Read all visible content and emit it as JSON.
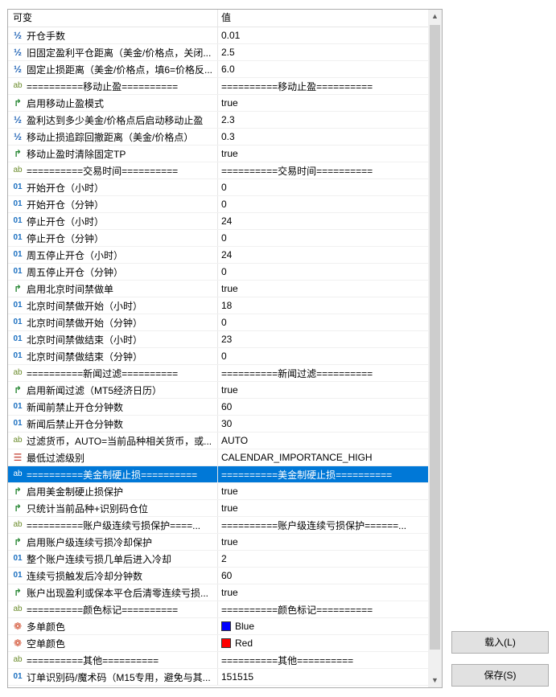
{
  "header": {
    "col1": "可变",
    "col2": "值"
  },
  "rows": [
    {
      "type": "double",
      "name": "开仓手数",
      "value": "0.01"
    },
    {
      "type": "double",
      "name": "旧固定盈利平仓距离（美金/价格点，关闭...",
      "value": "2.5"
    },
    {
      "type": "double",
      "name": "固定止损距离（美金/价格点，填6=价格反...",
      "value": "6.0"
    },
    {
      "type": "string",
      "name": "==========移动止盈==========",
      "value": "==========移动止盈=========="
    },
    {
      "type": "bool",
      "name": "启用移动止盈模式",
      "value": "true"
    },
    {
      "type": "double",
      "name": "盈利达到多少美金/价格点后启动移动止盈",
      "value": "2.3"
    },
    {
      "type": "double",
      "name": "移动止损追踪回撤距离（美金/价格点）",
      "value": "0.3"
    },
    {
      "type": "bool",
      "name": "移动止盈时清除固定TP",
      "value": "true"
    },
    {
      "type": "string",
      "name": "==========交易时间==========",
      "value": "==========交易时间=========="
    },
    {
      "type": "int",
      "name": "开始开仓（小时）",
      "value": "0"
    },
    {
      "type": "int",
      "name": "开始开仓（分钟）",
      "value": "0"
    },
    {
      "type": "int",
      "name": "停止开仓（小时）",
      "value": "24"
    },
    {
      "type": "int",
      "name": "停止开仓（分钟）",
      "value": "0"
    },
    {
      "type": "int",
      "name": "周五停止开仓（小时）",
      "value": "24"
    },
    {
      "type": "int",
      "name": "周五停止开仓（分钟）",
      "value": "0"
    },
    {
      "type": "bool",
      "name": "启用北京时间禁做单",
      "value": "true"
    },
    {
      "type": "int",
      "name": "北京时间禁做开始（小时）",
      "value": "18"
    },
    {
      "type": "int",
      "name": "北京时间禁做开始（分钟）",
      "value": "0"
    },
    {
      "type": "int",
      "name": "北京时间禁做结束（小时）",
      "value": "23"
    },
    {
      "type": "int",
      "name": "北京时间禁做结束（分钟）",
      "value": "0"
    },
    {
      "type": "string",
      "name": "==========新闻过滤==========",
      "value": "==========新闻过滤=========="
    },
    {
      "type": "bool",
      "name": "启用新闻过滤（MT5经济日历）",
      "value": "true"
    },
    {
      "type": "int",
      "name": "新闻前禁止开仓分钟数",
      "value": "60"
    },
    {
      "type": "int",
      "name": "新闻后禁止开仓分钟数",
      "value": "30"
    },
    {
      "type": "string",
      "name": "过滤货币，AUTO=当前品种相关货币，或...",
      "value": "AUTO"
    },
    {
      "type": "enum",
      "name": "最低过滤级别",
      "value": "CALENDAR_IMPORTANCE_HIGH"
    },
    {
      "type": "string",
      "name": "==========美金制硬止损==========",
      "value": "==========美金制硬止损==========",
      "selected": true
    },
    {
      "type": "bool",
      "name": "启用美金制硬止损保护",
      "value": "true"
    },
    {
      "type": "bool",
      "name": "只统计当前品种+识别码仓位",
      "value": "true"
    },
    {
      "type": "string",
      "name": "==========账户级连续亏损保护====...",
      "value": "==========账户级连续亏损保护======..."
    },
    {
      "type": "bool",
      "name": "启用账户级连续亏损冷却保护",
      "value": "true"
    },
    {
      "type": "int",
      "name": "整个账户连续亏损几单后进入冷却",
      "value": "2"
    },
    {
      "type": "int",
      "name": "连续亏损触发后冷却分钟数",
      "value": "60"
    },
    {
      "type": "bool",
      "name": "账户出现盈利或保本平仓后清零连续亏损...",
      "value": "true"
    },
    {
      "type": "string",
      "name": "==========颜色标记==========",
      "value": "==========颜色标记=========="
    },
    {
      "type": "color",
      "name": "多单颜色",
      "value": "Blue",
      "swatch": "#0000ff"
    },
    {
      "type": "color",
      "name": "空单颜色",
      "value": "Red",
      "swatch": "#ff0000"
    },
    {
      "type": "string",
      "name": "==========其他==========",
      "value": "==========其他=========="
    },
    {
      "type": "int",
      "name": "订单识别码/魔术码（M15专用，避免与其...",
      "value": "151515"
    }
  ],
  "type_icons": {
    "double": "½",
    "int": "01",
    "string": "ab",
    "bool": "↱",
    "enum": "☰",
    "color": "❁"
  },
  "icon_names": {
    "double": "double-type-icon",
    "int": "integer-type-icon",
    "string": "string-type-icon",
    "bool": "boolean-type-icon",
    "enum": "enum-type-icon",
    "color": "color-type-icon"
  },
  "scrollbar": {
    "up_glyph": "▲",
    "down_glyph": "▼"
  },
  "buttons": {
    "load": "载入(L)",
    "save": "保存(S)"
  },
  "colors": {
    "selection": "#0078d7",
    "blue": "#0000ff",
    "red": "#ff0000"
  }
}
